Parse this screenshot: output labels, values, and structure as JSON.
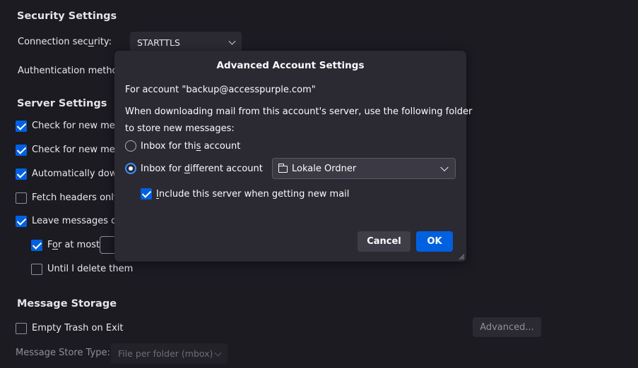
{
  "background": {
    "security": {
      "title": "Security Settings",
      "connection_label_pre": "Connection sec",
      "connection_label_key": "u",
      "connection_label_post": "rity:",
      "connection_value": "STARTTLS",
      "auth_label": "Authentication metho"
    },
    "server": {
      "title": "Server Settings",
      "items": [
        {
          "label": "Check for new mes",
          "checked": true
        },
        {
          "label": "Check for new mes",
          "checked": true
        },
        {
          "label": "Automatically dowr",
          "checked": true
        },
        {
          "label": "Fetch headers only",
          "checked": false
        },
        {
          "label": "Leave messages or",
          "checked": true
        }
      ],
      "for_at_most_pre": "F",
      "for_at_most_key": "o",
      "for_at_most_post": "r at most",
      "until_delete": "Until I delete them"
    },
    "storage": {
      "title": "Message Storage",
      "empty_trash": "Empty Trash on Exit",
      "advanced_button": "Advanced...",
      "store_type_label": "Message Store Type:",
      "store_type_value": "File per folder (mbox)"
    }
  },
  "dialog": {
    "title": "Advanced Account Settings",
    "account_line": "For account \"backup@accesspurple.com\"",
    "description_line1": "When downloading mail from this account's server, use the following folder",
    "description_line2": "to store new messages:",
    "radio_this_account": "Inbox for this account",
    "radio_different_account": "Inbox for different account",
    "folder_select_value": "Lokale Ordner",
    "include_server_label": "Include this server when getting new mail",
    "cancel_button": "Cancel",
    "ok_button": "OK"
  },
  "colors": {
    "background": "#1c1b22",
    "dialog": "#2b2a33",
    "accent": "#0061e0"
  }
}
